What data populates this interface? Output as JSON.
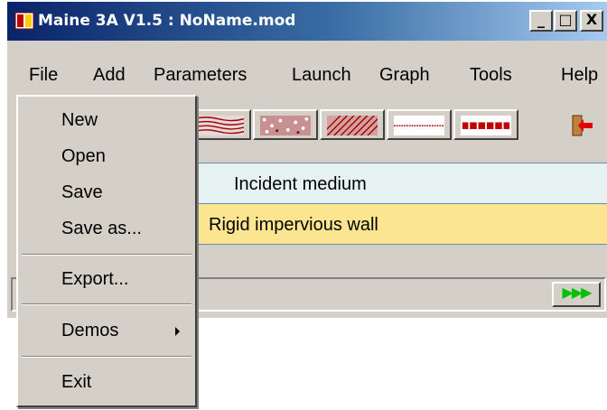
{
  "window": {
    "title": "Maine 3A V1.5 : NoName.mod",
    "controls": {
      "minimize": "_",
      "maximize": "□",
      "close": "X"
    }
  },
  "menubar": [
    "File",
    "Add",
    "Parameters",
    "Launch",
    "Graph",
    "Tools",
    "Help"
  ],
  "toolbar": {
    "icons": [
      "wavy-layer-icon",
      "porous-layer-icon",
      "hatched-layer-icon",
      "thin-plate-layer-icon",
      "perforated-layer-icon",
      "exit-door-icon"
    ]
  },
  "layers": {
    "incident": "Incident medium",
    "wall": "Rigid impervious wall"
  },
  "statusbar": {
    "run_label": "▶▶▶"
  },
  "file_menu": {
    "new": "New",
    "open": "Open",
    "save": "Save",
    "save_as": "Save as...",
    "export": "Export...",
    "demos": "Demos",
    "exit": "Exit"
  },
  "colors": {
    "incident_bg": "#e6f2f2",
    "wall_bg": "#fce590",
    "run_arrows": "#00c000"
  }
}
